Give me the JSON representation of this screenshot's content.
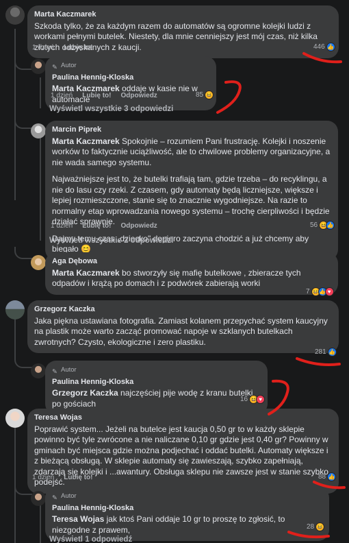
{
  "labels": {
    "time": "1 dzień",
    "like": "Lubię to!",
    "reply": "Odpowiedz",
    "author_badge": "Autor"
  },
  "comments": [
    {
      "author": "Marta Kaczmarek",
      "text": "Szkoda tylko, że za każdym razem do automatów są ogromne kolejki ludzi z workami pełnymi butelek. Niestety, dla mnie cenniejszy jest mój czas, niż kilka złotych odzyskanych z kaucji.",
      "reactions": "446"
    },
    {
      "author": "Paulina Hennig-Kloska",
      "mention": "Marta Kaczmarek",
      "text": " oddaje w kasie nie w automacie",
      "reactions": "85"
    },
    {
      "author": "Marcin Piprek",
      "mention": "Marta Kaczmarek",
      "p1": " Spokojnie – rozumiem Pani frustrację. Kolejki i noszenie worków to faktycznie uciążliwość, ale to chwilowe problemy organizacyjne, a nie wada samego systemu.",
      "p2": "Najważniejsze jest to, że butelki trafiają tam, gdzie trzeba – do recyklingu, a nie do lasu czy rzeki. Z czasem, gdy automaty będą liczniejsze, większe i lepiej rozmieszczone, stanie się to znacznie wygodniejsze. Na razie to normalny etap wprowadzania nowego systemu – trochę cierpliwości i będzie działać sprawnie.",
      "p3": "Dajmy temu czas „dziecko\" dopiero zaczyna chodzić a już chcemy aby biegało 😊",
      "reactions": "56"
    },
    {
      "author": "Aga Dębowa",
      "mention": "Marta Kaczmarek",
      "text": " bo stworzyły się mafię butelkowe , zbieracze tych odpadów i krążą po domach i z podwórek zabierają worki",
      "reactions": "7"
    },
    {
      "author": "Grzegorz Kaczka",
      "text": "Jaka piękna ustawiana fotografia. Zamiast kolanem przepychać system kaucyjny na plastik może warto zacząć promować napoje w szklanych butelkach zwrotnych? Czysto, ekologiczne i zero plastiku.",
      "reactions": "281"
    },
    {
      "author": "Paulina Hennig-Kloska",
      "mention": "Grzegorz Kaczka",
      "text": " najczęściej pije wodę z kranu butelki po gościach",
      "reactions": "16"
    },
    {
      "author": "Teresa Wojas",
      "text": "Poprawić system... Jeżeli na butelce jest kaucja 0,50 gr to w każdy sklepie powinno być tyle zwrócone a nie naliczane 0,10 gr gdzie jest 0,40 gr? Powinny w gminach być miejsca gdzie można podjechać i oddać butelki. Automaty większe i z bieżącą obsługą. W sklepie automaty się zawieszają, szybko zapełniają, zdarzają się kolejki i ...awantury. Obsługa sklepu nie zawsze jest w stanie szybko podejść.",
      "reactions": "88"
    },
    {
      "author": "Paulina Hennig-Kloska",
      "mention": "Teresa Wojas",
      "text": " jak ktoś Pani oddaje 10 gr to proszę to zgłosić, to niezgodne z prawem,",
      "reactions": "28"
    }
  ],
  "view_replies": [
    "Wyświetl wszystkie 3 odpowiedzi",
    "Wyświetl wszystkie 2 odpowiedzi",
    "Wyświetl 1 odpowiedź"
  ],
  "colors": {
    "background": "#18191a",
    "bubble": "#3a3b3c",
    "like": "#1877f2",
    "annotation": "#e0201b"
  }
}
